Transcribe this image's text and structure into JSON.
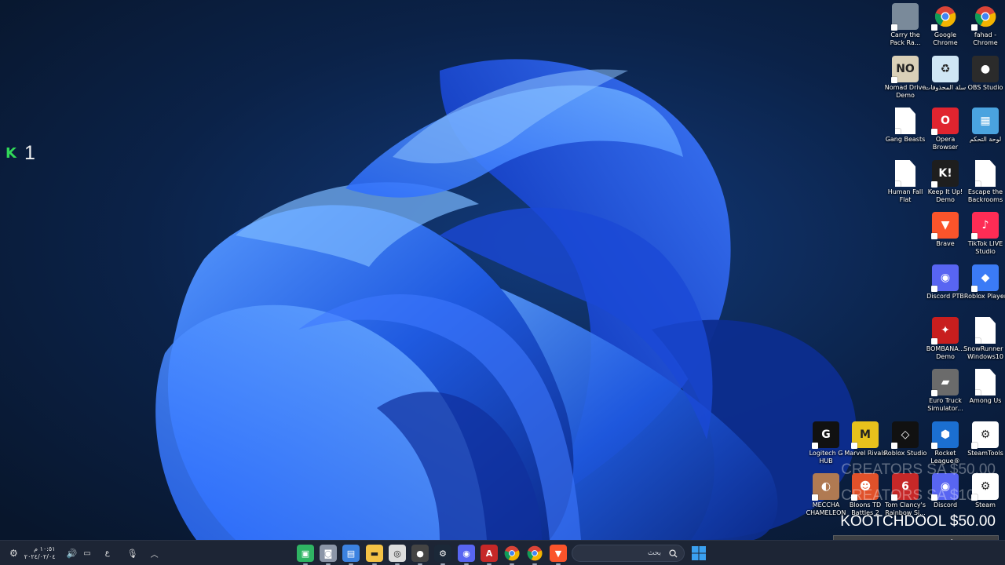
{
  "counter": {
    "icon": "kick-icon",
    "k": "K",
    "value": "1"
  },
  "desktop_icons": [
    {
      "label": "Carry the Pack Ra...",
      "icon": "game-thumb-icon",
      "color": "#7a8a9a",
      "glyph": ""
    },
    {
      "label": "Google Chrome",
      "icon": "chrome-icon",
      "color": "#ffffff",
      "glyph": ""
    },
    {
      "label": "fahad - Chrome",
      "icon": "chrome-profile-icon",
      "color": "#ffffff",
      "glyph": ""
    },
    {
      "label": "Nomad Drive Demo",
      "icon": "nomad-drive-icon",
      "color": "#d9d0b8",
      "glyph": "NO"
    },
    {
      "label": "سلة المحذوفات",
      "icon": "recycle-bin-icon",
      "color": "#cfe6f5",
      "glyph": "♻"
    },
    {
      "label": "OBS Studio",
      "icon": "obs-icon",
      "color": "#2b2b2b",
      "glyph": "●"
    },
    {
      "label": "Gang Beasts",
      "icon": "document-icon",
      "color": "#ffffff",
      "glyph": ""
    },
    {
      "label": "Opera Browser",
      "icon": "opera-icon",
      "color": "#e0242f",
      "glyph": "O"
    },
    {
      "label": "لوحة التحكم",
      "icon": "control-panel-icon",
      "color": "#4aa3df",
      "glyph": "▦"
    },
    {
      "label": "Human Fall Flat",
      "icon": "document-icon",
      "color": "#ffffff",
      "glyph": ""
    },
    {
      "label": "Keep It Up! Demo",
      "icon": "keep-it-up-icon",
      "color": "#1e1e1e",
      "glyph": "K!"
    },
    {
      "label": "Escape the Backrooms",
      "icon": "document-icon",
      "color": "#ffffff",
      "glyph": ""
    },
    {
      "label": "Brave",
      "icon": "brave-icon",
      "color": "#fb542b",
      "glyph": "▼"
    },
    {
      "label": "TikTok LIVE Studio",
      "icon": "tiktok-icon",
      "color": "#fe2c55",
      "glyph": "♪"
    },
    {
      "label": "Discord PTB",
      "icon": "discord-icon",
      "color": "#5865f2",
      "glyph": "◉"
    },
    {
      "label": "Roblox Player",
      "icon": "roblox-icon",
      "color": "#3b7bf6",
      "glyph": "◆"
    },
    {
      "label": "BOMBANA... Demo",
      "icon": "bombana-icon",
      "color": "#c81e1e",
      "glyph": "✦"
    },
    {
      "label": "SnowRunner - Windows10",
      "icon": "document-icon",
      "color": "#ffffff",
      "glyph": ""
    },
    {
      "label": "Euro Truck Simulator...",
      "icon": "euro-truck-icon",
      "color": "#6b6b6b",
      "glyph": "▰"
    },
    {
      "label": "Among Us",
      "icon": "document-icon",
      "color": "#ffffff",
      "glyph": ""
    },
    {
      "label": "Logitech G HUB",
      "icon": "logitech-icon",
      "color": "#111111",
      "glyph": "G"
    },
    {
      "label": "Marvel Rivals",
      "icon": "marvel-rivals-icon",
      "color": "#e7c11c",
      "glyph": "M"
    },
    {
      "label": "Roblox Studio",
      "icon": "roblox-studio-icon",
      "color": "#111111",
      "glyph": "◇"
    },
    {
      "label": "Rocket League®",
      "icon": "rocket-league-icon",
      "color": "#1b6fd1",
      "glyph": "⬢"
    },
    {
      "label": "SteamTools",
      "icon": "steamtools-icon",
      "color": "#ffffff",
      "glyph": "⚙"
    },
    {
      "label": "MECCHA CHAMELEON",
      "icon": "meccha-icon",
      "color": "#b07a52",
      "glyph": "◐"
    },
    {
      "label": "Bloons TD Battles 2",
      "icon": "bloons-icon",
      "color": "#e0512a",
      "glyph": "☻"
    },
    {
      "label": "Tom Clancy's Rainbow Si...",
      "icon": "rainbow-six-icon",
      "color": "#c62828",
      "glyph": "6"
    },
    {
      "label": "Discord",
      "icon": "discord-icon",
      "color": "#5865f2",
      "glyph": "◉"
    },
    {
      "label": "Steam",
      "icon": "steam-icon",
      "color": "#ffffff",
      "glyph": "⚙"
    }
  ],
  "overlay": [
    {
      "text": "CREATORS SA  $50.00",
      "style": "faded"
    },
    {
      "text": "CREATORS SA  $10.00",
      "style": "faded"
    },
    {
      "text": "KOOTCHDOOL  $50.00",
      "style": "solid"
    },
    {
      "text": "CREATORS SA  $10.00",
      "style": "boxed"
    }
  ],
  "taskbar": {
    "search_text": "بحث",
    "apps": [
      {
        "icon": "app-green-icon",
        "color": "#2fb463",
        "glyph": "▣"
      },
      {
        "icon": "camera-icon",
        "color": "#8c96a8",
        "glyph": "◙"
      },
      {
        "icon": "store-icon",
        "color": "#3c82e0",
        "glyph": "▤"
      },
      {
        "icon": "file-explorer-icon",
        "color": "#f4c245",
        "glyph": "▬"
      },
      {
        "icon": "chrome-alt-icon",
        "color": "#dddddd",
        "glyph": "◎"
      },
      {
        "icon": "record-icon",
        "color": "#444444",
        "glyph": "●"
      },
      {
        "icon": "steam-taskbar-icon",
        "color": "#1b2838",
        "glyph": "⚙"
      },
      {
        "icon": "discord-taskbar-icon",
        "color": "#5865f2",
        "glyph": "◉"
      },
      {
        "icon": "adobe-icon",
        "color": "#c62828",
        "glyph": "A"
      },
      {
        "icon": "chrome-taskbar-icon",
        "color": "#ffffff",
        "glyph": ""
      },
      {
        "icon": "chrome-profile-taskbar-icon",
        "color": "#ffffff",
        "glyph": ""
      },
      {
        "icon": "brave-taskbar-icon",
        "color": "#fb542b",
        "glyph": "▼"
      }
    ],
    "tray": {
      "time": "١٠:٥١ م",
      "date": "٢٠٢٤/٠٢/٠٤",
      "lang": "ع"
    }
  }
}
